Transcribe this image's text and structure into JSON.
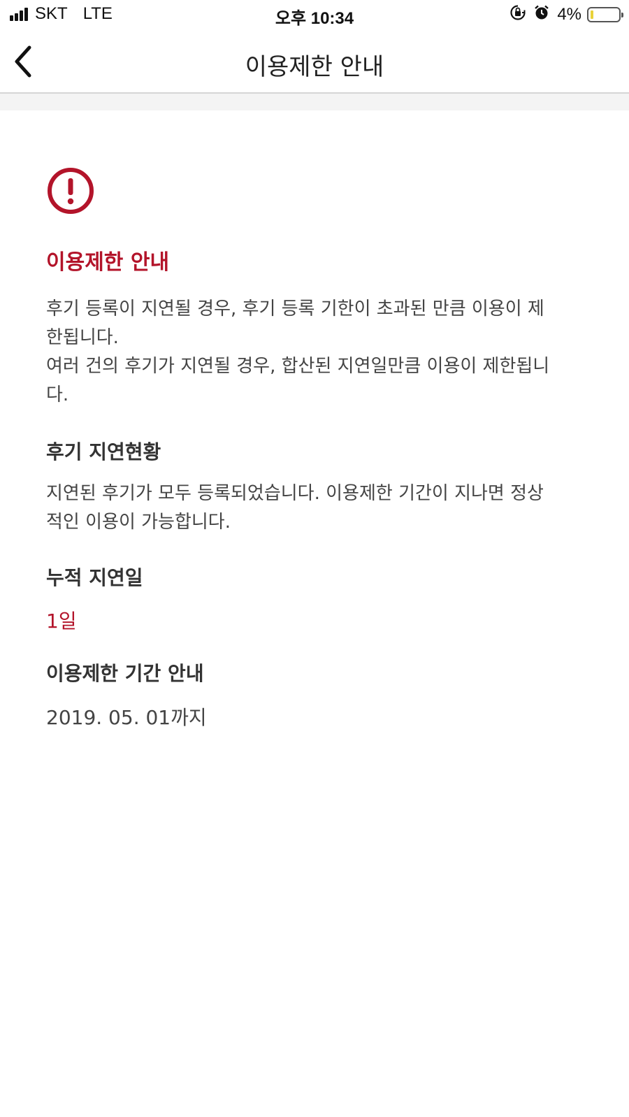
{
  "status_bar": {
    "carrier": "SKT",
    "network": "LTE",
    "time": "오후 10:34",
    "battery": "4%",
    "battery_level": 0.04,
    "icons": [
      "signal-icon",
      "rotation-lock-icon",
      "alarm-icon",
      "battery-icon"
    ]
  },
  "nav": {
    "back_icon": "chevron-left-icon",
    "title": "이용제한 안내"
  },
  "alert": {
    "icon": "exclamation-circle-icon",
    "color": "#b3142a",
    "heading": "이용제한 안내",
    "lines": [
      "후기 등록이 지연될 경우, 후기 등록 기한이 초과된 만큼 이용이 제",
      "한됩니다.",
      "여러 건의 후기가 지연될 경우, 합산된 지연일만큼 이용이 제한됩니",
      "다."
    ]
  },
  "delay_status": {
    "heading": "후기 지연현황",
    "lines": [
      "지연된 후기가 모두 등록되었습니다. 이용제한 기간이 지나면 정상",
      "적인 이용이 가능합니다."
    ]
  },
  "accumulated": {
    "heading": "누적 지연일",
    "value": "1일"
  },
  "period": {
    "heading": "이용제한 기간 안내",
    "value": "2019. 05. 01까지"
  }
}
